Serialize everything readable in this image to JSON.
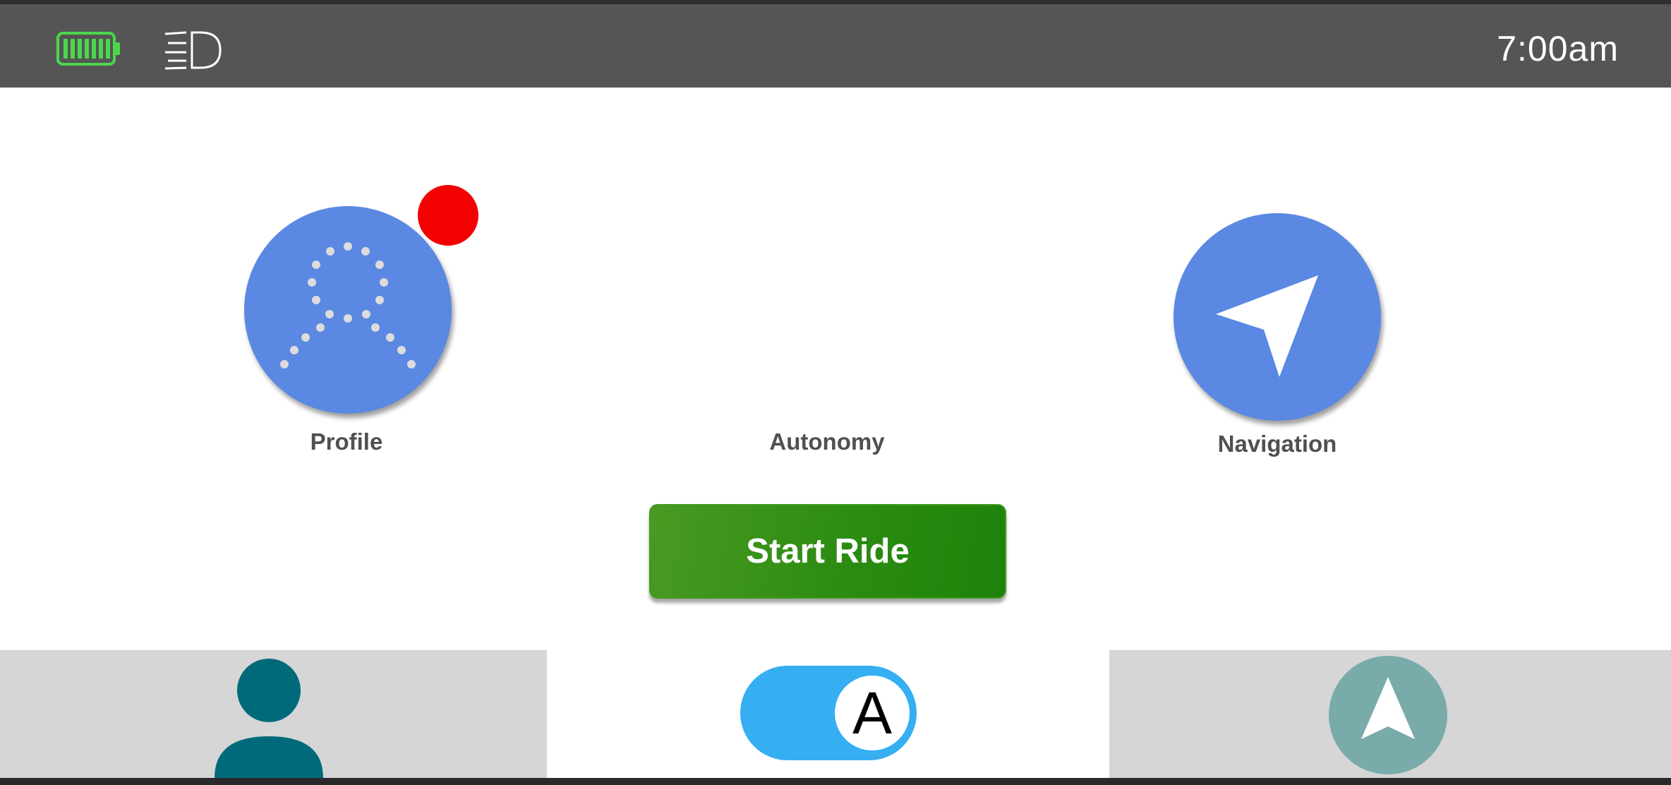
{
  "status_bar": {
    "battery_icon": "battery-full-icon",
    "battery_color": "#4cd64c",
    "headlight_icon": "headlight-icon",
    "time": "7:00am"
  },
  "main": {
    "profile": {
      "label": "Profile",
      "icon": "profile-dots-icon",
      "has_notification": true,
      "notification_color": "#f30000"
    },
    "autonomy": {
      "label": "Autonomy"
    },
    "navigation": {
      "label": "Navigation",
      "icon": "navigation-arrow-icon"
    },
    "start_button": {
      "label": "Start Ride",
      "color": "#2c8c12"
    }
  },
  "bottom_nav": {
    "profile_tab": {
      "icon": "person-icon",
      "color": "#006a7a"
    },
    "autonomy_tab": {
      "toggle_letter": "A",
      "toggle_on": true,
      "toggle_color": "#35aef2"
    },
    "navigation_tab": {
      "icon": "navigation-arrow-icon",
      "color": "#7aabab"
    }
  },
  "colors": {
    "accent_blue": "#5a88e2",
    "status_bar_bg": "#555555",
    "tab_bg": "#d6d6d6"
  }
}
